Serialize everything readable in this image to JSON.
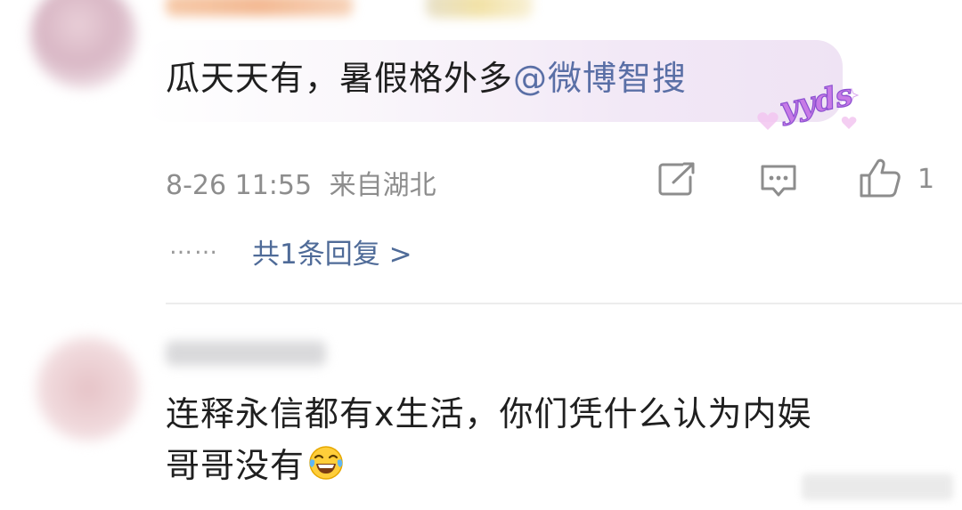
{
  "comment1": {
    "text": "瓜天天有，暑假格外多",
    "mention": "@微博智搜",
    "sticker_text": "yyds",
    "timestamp": "8-26 11:55",
    "location": "来自湖北",
    "like_count": "1",
    "reply_dots": "……",
    "reply_link": "共1条回复 >"
  },
  "comment2": {
    "line1": "连释永信都有x生活，你们凭什么认为内娱",
    "line2": "哥哥没有"
  },
  "icons": [
    "share-icon",
    "comment-icon",
    "like-icon",
    "laughing-emoji-icon"
  ],
  "colors": {
    "mention": "#5a6fa6",
    "meta": "#8d8d8d",
    "bubble": "#efe3f4"
  }
}
